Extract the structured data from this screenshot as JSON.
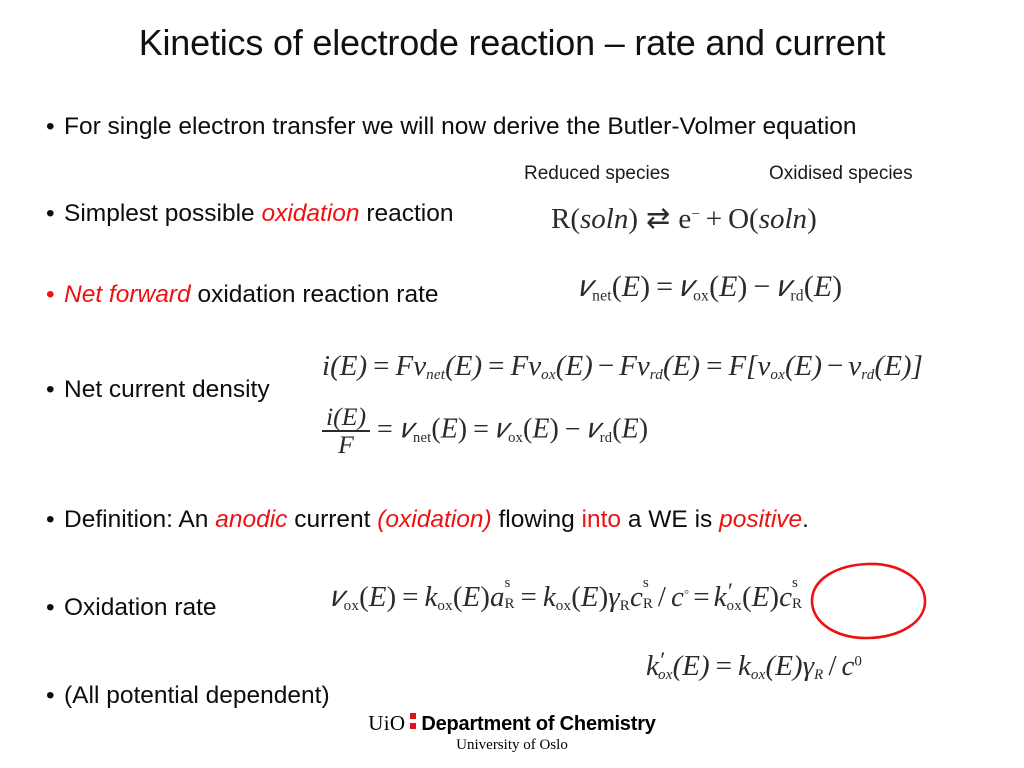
{
  "slide": {
    "title": "Kinetics of electrode reaction – rate and current",
    "accent_color": "#ee1111",
    "text_color": "#0d0d0d",
    "background_color": "#ffffff"
  },
  "bullets": {
    "b1": {
      "text": "For single electron transfer we will now derive the Butler-Volmer equation"
    },
    "b2": {
      "pre": "Simplest possible ",
      "em": "oxidation",
      "post": " reaction"
    },
    "b3": {
      "em": "Net forward",
      "post": " oxidation reaction rate"
    },
    "b4": {
      "text": "Net current density"
    },
    "b5": {
      "p1": "Definition: An ",
      "e1": "anodic",
      "p2": " current ",
      "e2": "(oxidation)",
      "p3": " flowing ",
      "e3": "into",
      "p4": " a WE is ",
      "e4": "positive",
      "p5": "."
    },
    "b6": {
      "text": "Oxidation rate"
    },
    "b7": {
      "text": "(All potential dependent)"
    }
  },
  "captions": {
    "reduced": "Reduced species",
    "oxidised": "Oxidised species"
  },
  "equations": {
    "reaction": {
      "label": "R(soln) ⇄ e⁻ + O(soln)",
      "lhs_species": "R",
      "lhs_state": "soln",
      "arrow": "⇄",
      "electron": "e",
      "electron_charge": "−",
      "plus": "+",
      "rhs_species": "O",
      "rhs_state": "soln"
    },
    "net_rate": {
      "label": "v_net(E) = v_ox(E) − v_rd(E)",
      "v": "v",
      "sub_net": "net",
      "sub_ox": "ox",
      "sub_rd": "rd",
      "E": "E",
      "eq": "=",
      "minus": "−"
    },
    "current_density": {
      "label": "i(E) = Fv_net(E) = Fv_ox(E) − Fv_rd(E) = F[v_ox(E) − v_rd(E)]",
      "i": "i",
      "F": "F",
      "v": "v",
      "sub_net": "net",
      "sub_ox": "ox",
      "sub_rd": "rd",
      "E": "E",
      "eq": "=",
      "minus": "−",
      "lbracket": "[",
      "rbracket": "]"
    },
    "current_over_F": {
      "label": "i(E)/F = v_net(E) = v_ox(E) − v_rd(E)",
      "num_i": "i",
      "den_F": "F",
      "v": "v",
      "sub_net": "net",
      "sub_ox": "ox",
      "sub_rd": "rd",
      "E": "E",
      "eq": "=",
      "minus": "−"
    },
    "oxidation_rate": {
      "label": "v_ox(E) = k_ox(E)a_R^s = k_ox(E)γ_R c_R^s / c° = k'_ox(E)c_R^s",
      "v": "v",
      "k": "k",
      "prime": "′",
      "a": "a",
      "c": "c",
      "gamma": "γ",
      "sub_ox": "ox",
      "sub_R": "R",
      "sup_s": "s",
      "sup_standard": "◦",
      "E": "E",
      "eq": "=",
      "slash": "/"
    },
    "k_prime": {
      "label": "k'_ox(E) = k_ox(E)γ_R / c⁰",
      "k": "k",
      "prime": "′",
      "sub_ox": "ox",
      "sub_R": "R",
      "gamma": "γ",
      "c": "c",
      "sup_zero": "0",
      "E": "E",
      "eq": "=",
      "slash": "/"
    }
  },
  "annotations": {
    "circle": {
      "shape": "hand-drawn-ellipse",
      "color": "#ee1111",
      "targets": "k'_ox(E)"
    }
  },
  "footer": {
    "uio": "UiO",
    "department": "Department of Chemistry",
    "university": "University of Oslo",
    "dot_color": "#dd1122"
  }
}
